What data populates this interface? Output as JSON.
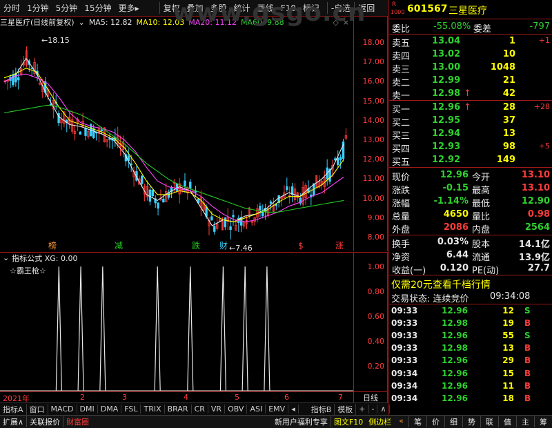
{
  "toolbar": {
    "items": [
      "分时",
      "1分钟",
      "5分钟",
      "15分钟",
      "更多▸",
      "复权",
      "叠加",
      "多股",
      "统计",
      "画线",
      "F10",
      "标记",
      "-自选",
      "返回"
    ]
  },
  "chart_header": {
    "stock_title": "三星医疗(日线前复权)",
    "ma5": "MA5: 12.82",
    "ma10": "MA10: 12.03",
    "ma20": "MA20: 11.12",
    "ma60": "MA60: 9.88",
    "watermark": "www.gsgo.cn"
  },
  "colors": {
    "ma5": "#e8e8e8",
    "ma10": "#ffff00",
    "ma20": "#ff44ff",
    "ma60": "#22cc22",
    "up": "#ff3b3b",
    "down": "#38d0ff"
  },
  "chart_data": {
    "type": "line",
    "ylim": [
      7.5,
      18.5
    ],
    "price_ticks": [
      "18.00",
      "17.00",
      "16.00",
      "15.00",
      "14.00",
      "13.00",
      "12.00",
      "11.00",
      "10.00",
      "9.00",
      "8.00"
    ],
    "high_label": "18.15",
    "low_label": "7.46",
    "markers": [
      "榜",
      "减",
      "跌",
      "财",
      "$",
      "涨"
    ],
    "series": [
      {
        "name": "MA5",
        "values": [
          16.0,
          16.3,
          17.2,
          16.4,
          15.2,
          14.2,
          13.8,
          13.7,
          13.5,
          13.3,
          13.0,
          12.3,
          11.2,
          10.2,
          9.9,
          10.3,
          10.6,
          10.4,
          9.5,
          8.6,
          8.9,
          8.8,
          9.1,
          9.2,
          9.5,
          10.0,
          10.3,
          10.1,
          10.6,
          11.0,
          11.6,
          12.8
        ]
      },
      {
        "name": "MA10",
        "values": [
          16.2,
          16.4,
          16.7,
          16.5,
          15.6,
          14.7,
          14.0,
          13.8,
          13.6,
          13.4,
          13.1,
          12.6,
          11.8,
          10.9,
          10.2,
          10.2,
          10.4,
          10.3,
          9.9,
          9.2,
          8.9,
          8.8,
          9.0,
          9.2,
          9.4,
          9.8,
          10.1,
          10.1,
          10.4,
          10.7,
          11.2,
          12.0
        ]
      },
      {
        "name": "MA20",
        "values": [
          16.0,
          16.3,
          16.4,
          16.2,
          15.9,
          15.2,
          14.4,
          13.9,
          13.7,
          13.6,
          13.4,
          13.0,
          12.4,
          11.6,
          10.9,
          10.6,
          10.5,
          10.4,
          10.1,
          9.6,
          9.2,
          8.9,
          8.8,
          8.9,
          9.1,
          9.3,
          9.6,
          9.8,
          10.1,
          10.3,
          10.7,
          11.1
        ]
      },
      {
        "name": "MA60",
        "values": [
          14.4,
          14.5,
          14.6,
          14.7,
          14.8,
          14.7,
          14.5,
          14.3,
          14.0,
          13.6,
          13.2,
          12.8,
          12.3,
          11.8,
          11.4,
          11.0,
          10.7,
          10.5,
          10.3,
          10.1,
          9.9,
          9.7,
          9.5,
          9.4,
          9.3,
          9.3,
          9.4,
          9.5,
          9.6,
          9.7,
          9.8,
          9.9
        ]
      }
    ]
  },
  "indicator": {
    "title": "指标公式 XG: 0.00",
    "name": "☆霸王枪☆",
    "ticks": [
      "1.00",
      "0.80",
      "0.60",
      "0.40",
      "0.20"
    ],
    "signals": [
      5,
      7,
      9,
      14,
      17,
      20,
      22,
      24
    ]
  },
  "date_axis": [
    "2021年",
    "2",
    "3",
    "4",
    "5",
    "6",
    "7"
  ],
  "period_label": "日线",
  "indicator_tabs": [
    "指标A",
    "窗口",
    "MACD",
    "DMI",
    "DMA",
    "FSL",
    "TRIX",
    "BRAR",
    "CR",
    "VR",
    "OBV",
    "ASI",
    "EMV",
    "◂",
    "指标B",
    "模板",
    "+",
    "-",
    "∧"
  ],
  "status_bar": {
    "left": [
      "扩展∧",
      "关联报价",
      "财富圈"
    ],
    "ticker_text": "新用户福利专享",
    "f10": "图文F10",
    "sidebar": "侧边栏",
    "right": [
      "«",
      "笔",
      "价",
      "细",
      "势",
      "联",
      "值",
      "主",
      "筹"
    ]
  },
  "quote": {
    "badge_r": "R",
    "badge_1000": "1000",
    "code": "601567",
    "name": "三星医疗",
    "weibi_label": "委比",
    "weibi": "-55.08%",
    "weicha_label": "委差",
    "weicha": "-797",
    "asks": [
      {
        "label": "卖五",
        "price": "13.04",
        "vol": "1",
        "chg": "+1"
      },
      {
        "label": "卖四",
        "price": "13.02",
        "vol": "10",
        "chg": ""
      },
      {
        "label": "卖三",
        "price": "13.00",
        "vol": "1048",
        "chg": ""
      },
      {
        "label": "卖二",
        "price": "12.99",
        "vol": "21",
        "chg": ""
      },
      {
        "label": "卖一",
        "price": "12.98",
        "vol": "42",
        "chg": "",
        "arrow": "↑"
      }
    ],
    "bids": [
      {
        "label": "买一",
        "price": "12.96",
        "vol": "28",
        "chg": "+28",
        "arrow": "↑"
      },
      {
        "label": "买二",
        "price": "12.95",
        "vol": "37",
        "chg": ""
      },
      {
        "label": "买三",
        "price": "12.94",
        "vol": "13",
        "chg": ""
      },
      {
        "label": "买四",
        "price": "12.93",
        "vol": "98",
        "chg": "+5"
      },
      {
        "label": "买五",
        "price": "12.92",
        "vol": "149",
        "chg": ""
      }
    ],
    "stats": [
      {
        "l1": "现价",
        "v1": "12.96",
        "l2": "今开",
        "v2": "13.10"
      },
      {
        "l1": "涨跌",
        "v1": "-0.15",
        "l2": "最高",
        "v2": "13.10"
      },
      {
        "l1": "涨幅",
        "v1": "-1.14%",
        "l2": "最低",
        "v2": "12.90"
      },
      {
        "l1": "总量",
        "v1": "4650",
        "l2": "量比",
        "v2": "0.98"
      },
      {
        "l1": "外盘",
        "v1": "2086",
        "l2": "内盘",
        "v2": "2564"
      }
    ],
    "fin": [
      {
        "l1": "换手",
        "v1": "0.03%",
        "l2": "股本",
        "v2": "14.1亿"
      },
      {
        "l1": "净资",
        "v1": "6.44",
        "l2": "流通",
        "v2": "13.9亿"
      },
      {
        "l1": "收益(一)",
        "v1": "0.120",
        "l2": "PE(动)",
        "v2": "27.7"
      }
    ],
    "promo": "仅需20元查看千档行情",
    "trade_status": "交易状态: 连续竞价",
    "trade_time": "09:34:08",
    "ticks": [
      {
        "t": "09:33",
        "p": "12.96",
        "v": "12",
        "s": "S"
      },
      {
        "t": "09:33",
        "p": "12.98",
        "v": "19",
        "s": "B"
      },
      {
        "t": "09:33",
        "p": "12.96",
        "v": "55",
        "s": "S"
      },
      {
        "t": "09:33",
        "p": "12.98",
        "v": "13",
        "s": "B"
      },
      {
        "t": "09:33",
        "p": "12.96",
        "v": "29",
        "s": "B"
      },
      {
        "t": "09:34",
        "p": "12.96",
        "v": "15",
        "s": "B"
      },
      {
        "t": "09:34",
        "p": "12.96",
        "v": "11",
        "s": "B"
      },
      {
        "t": "09:34",
        "p": "12.96",
        "v": "18",
        "s": "B"
      }
    ]
  }
}
